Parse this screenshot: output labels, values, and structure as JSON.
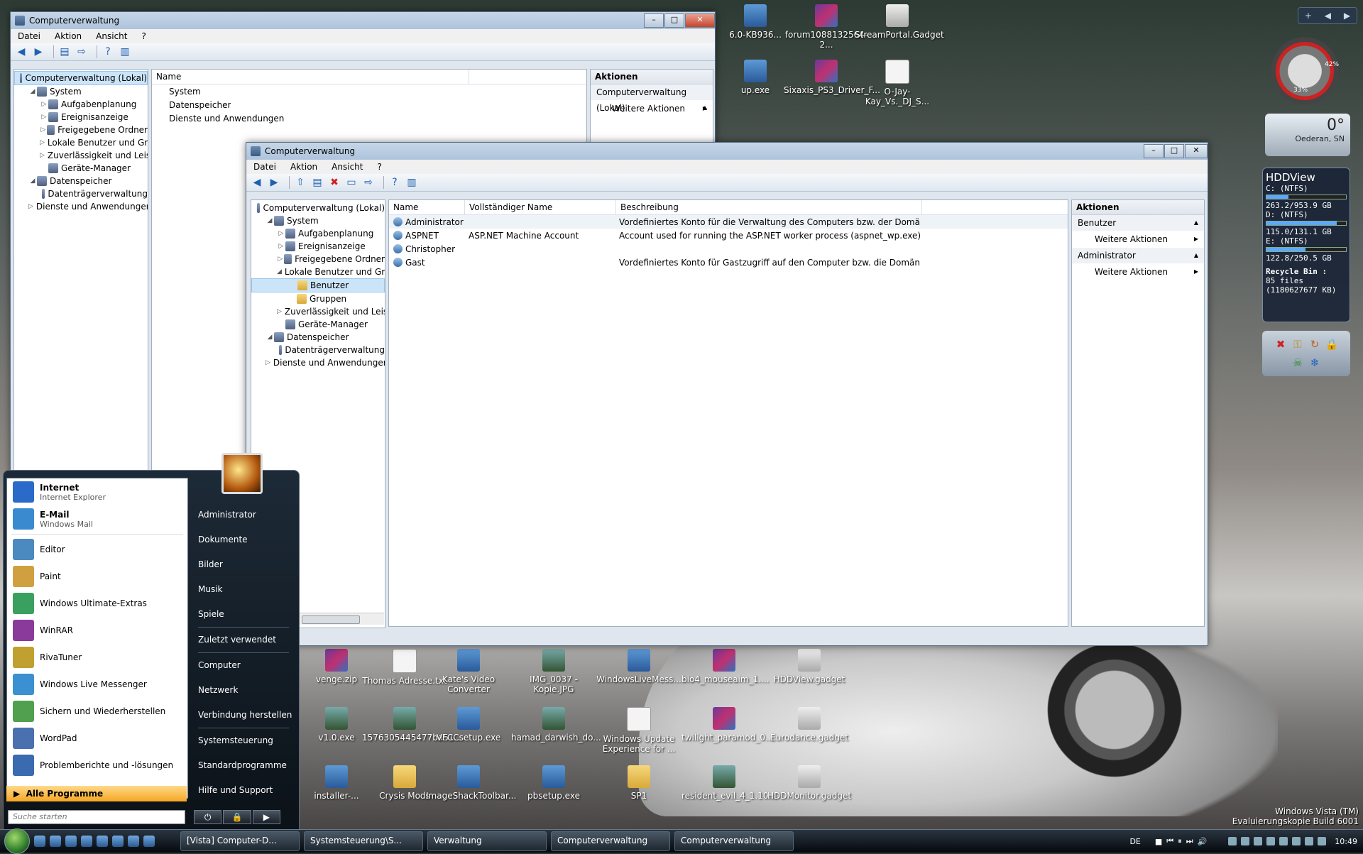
{
  "desktop_icons": [
    {
      "label": "6.0-KB936...",
      "type": "exe",
      "pos": "a1"
    },
    {
      "label": "forum1088132564-2...",
      "type": "rar",
      "pos": "a2"
    },
    {
      "label": "StreamPortal.Gadget",
      "type": "gadget",
      "pos": "a3"
    },
    {
      "label": "up.exe",
      "type": "exe",
      "pos": "b1"
    },
    {
      "label": "Sixaxis_PS3_Driver_F...",
      "type": "rar",
      "pos": "b2"
    },
    {
      "label": "O-Jay-Kay_Vs._DJ_S...",
      "type": "txt",
      "pos": "b3"
    },
    {
      "label": "venge.zip",
      "type": "rar",
      "pos": "c0"
    },
    {
      "label": "Thomas Adresse.txt",
      "type": "txt",
      "pos": "c1"
    },
    {
      "label": "Kate's Video Converter",
      "type": "exe",
      "pos": "c2"
    },
    {
      "label": "IMG_0037 - Kopie.JPG",
      "type": "img",
      "pos": "c3"
    },
    {
      "label": "WindowsLiveMess...",
      "type": "exe",
      "pos": "c4"
    },
    {
      "label": "bio4_mouseaim_1....",
      "type": "rar",
      "pos": "c5"
    },
    {
      "label": "HDDView.gadget",
      "type": "gadget",
      "pos": "c6"
    },
    {
      "label": "v1.0.exe",
      "type": "img",
      "pos": "d0"
    },
    {
      "label": "1576305445477ba51...",
      "type": "img",
      "pos": "d1"
    },
    {
      "label": "VFCCsetup.exe",
      "type": "exe",
      "pos": "d2"
    },
    {
      "label": "hamad_darwish_do...",
      "type": "img",
      "pos": "d3"
    },
    {
      "label": "Windows Update Experience for ...",
      "type": "txt",
      "pos": "d4"
    },
    {
      "label": "twilight_paramod_0...",
      "type": "rar",
      "pos": "d5"
    },
    {
      "label": "Eurodance.gadget",
      "type": "gadget",
      "pos": "d6"
    },
    {
      "label": "installer-...",
      "type": "exe",
      "pos": "e0"
    },
    {
      "label": "Crysis Mods",
      "type": "folder",
      "pos": "e1"
    },
    {
      "label": "ImageShackToolbar...",
      "type": "exe",
      "pos": "e2"
    },
    {
      "label": "pbsetup.exe",
      "type": "exe",
      "pos": "e3"
    },
    {
      "label": "SP1",
      "type": "folder",
      "pos": "e4"
    },
    {
      "label": "resident_evil_4_1.10...",
      "type": "img",
      "pos": "e5"
    },
    {
      "label": "HDDMonitor.gadget",
      "type": "gadget",
      "pos": "e6"
    }
  ],
  "back_window": {
    "title": "Computerverwaltung",
    "menu": [
      "Datei",
      "Aktion",
      "Ansicht",
      "?"
    ],
    "tree": [
      {
        "label": "Computerverwaltung (Lokal)",
        "level": 0,
        "arrow": "",
        "selected": true
      },
      {
        "label": "System",
        "level": 1,
        "arrow": "◢"
      },
      {
        "label": "Aufgabenplanung",
        "level": 2,
        "arrow": "▷"
      },
      {
        "label": "Ereignisanzeige",
        "level": 2,
        "arrow": "▷"
      },
      {
        "label": "Freigegebene Ordner",
        "level": 2,
        "arrow": "▷"
      },
      {
        "label": "Lokale Benutzer und Gr",
        "level": 2,
        "arrow": "▷"
      },
      {
        "label": "Zuverlässigkeit und Leis",
        "level": 2,
        "arrow": "▷"
      },
      {
        "label": "Geräte-Manager",
        "level": 2,
        "arrow": ""
      },
      {
        "label": "Datenspeicher",
        "level": 1,
        "arrow": "◢"
      },
      {
        "label": "Datenträgerverwaltung",
        "level": 2,
        "arrow": ""
      },
      {
        "label": "Dienste und Anwendungen",
        "level": 1,
        "arrow": "▷"
      }
    ],
    "list_header": "Name",
    "list_items": [
      "System",
      "Datenspeicher",
      "Dienste und Anwendungen"
    ],
    "actions_title": "Aktionen",
    "actions_section": "Computerverwaltung (Lokal)",
    "actions_item": "Weitere Aktionen"
  },
  "front_window": {
    "title": "Computerverwaltung",
    "menu": [
      "Datei",
      "Aktion",
      "Ansicht",
      "?"
    ],
    "tree": [
      {
        "label": "Computerverwaltung (Lokal)",
        "level": 0,
        "arrow": ""
      },
      {
        "label": "System",
        "level": 1,
        "arrow": "◢"
      },
      {
        "label": "Aufgabenplanung",
        "level": 2,
        "arrow": "▷"
      },
      {
        "label": "Ereignisanzeige",
        "level": 2,
        "arrow": "▷"
      },
      {
        "label": "Freigegebene Ordner",
        "level": 2,
        "arrow": "▷"
      },
      {
        "label": "Lokale Benutzer und Gr",
        "level": 2,
        "arrow": "◢"
      },
      {
        "label": "Benutzer",
        "level": 3,
        "arrow": "",
        "selected": true,
        "folder": true
      },
      {
        "label": "Gruppen",
        "level": 3,
        "arrow": "",
        "folder": true
      },
      {
        "label": "Zuverlässigkeit und Leis",
        "level": 2,
        "arrow": "▷"
      },
      {
        "label": "Geräte-Manager",
        "level": 2,
        "arrow": ""
      },
      {
        "label": "Datenspeicher",
        "level": 1,
        "arrow": "◢"
      },
      {
        "label": "Datenträgerverwaltung",
        "level": 2,
        "arrow": ""
      },
      {
        "label": "Dienste und Anwendungen",
        "level": 1,
        "arrow": "▷"
      }
    ],
    "columns": [
      "Name",
      "Vollständiger Name",
      "Beschreibung"
    ],
    "rows": [
      {
        "name": "Administrator",
        "full": "",
        "desc": "Vordefiniertes Konto für die Verwaltung des Computers bzw. der Domäne"
      },
      {
        "name": "ASPNET",
        "full": "ASP.NET Machine Account",
        "desc": "Account used for running the ASP.NET worker process (aspnet_wp.exe)"
      },
      {
        "name": "Christopher",
        "full": "",
        "desc": ""
      },
      {
        "name": "Gast",
        "full": "",
        "desc": "Vordefiniertes Konto für Gastzugriff auf den Computer bzw. die Domäne"
      }
    ],
    "actions_title": "Aktionen",
    "action_sections": [
      {
        "title": "Benutzer",
        "item": "Weitere Aktionen"
      },
      {
        "title": "Administrator",
        "item": "Weitere Aktionen"
      }
    ]
  },
  "start_menu": {
    "pinned": [
      {
        "title": "Internet",
        "subtitle": "Internet Explorer",
        "color": "#2a6ac8"
      },
      {
        "title": "E-Mail",
        "subtitle": "Windows Mail",
        "color": "#3a8ad0"
      }
    ],
    "recent": [
      {
        "title": "Editor",
        "color": "#4a8ac0"
      },
      {
        "title": "Paint",
        "color": "#d0a040"
      },
      {
        "title": "Windows Ultimate-Extras",
        "color": "#3aa060"
      },
      {
        "title": "WinRAR",
        "color": "#8a3a9a"
      },
      {
        "title": "RivaTuner",
        "color": "#c0a030"
      },
      {
        "title": "Windows Live Messenger",
        "color": "#3a90d0"
      },
      {
        "title": "Sichern und Wiederherstellen",
        "color": "#50a050"
      },
      {
        "title": "WordPad",
        "color": "#4a70b0"
      },
      {
        "title": "Problemberichte und -lösungen",
        "color": "#3a6ab0"
      }
    ],
    "all_programs": "Alle Programme",
    "search_placeholder": "Suche starten",
    "right_items": [
      "Administrator",
      "Dokumente",
      "Bilder",
      "Musik",
      "Spiele",
      "Zuletzt verwendet",
      "Computer",
      "Netzwerk",
      "Verbindung herstellen",
      "Systemsteuerung",
      "Standardprogramme",
      "Hilfe und Support"
    ],
    "power_icons": [
      "⏻",
      "🔒",
      "▶"
    ]
  },
  "taskbar": {
    "tasks": [
      "[Vista] Computer-D...",
      "Systemsteuerung\\S...",
      "Verwaltung",
      "Computerverwaltung",
      "Computerverwaltung"
    ],
    "lang": "DE",
    "clock": "10:49"
  },
  "gadgets": {
    "weather_temp": "0°",
    "weather_place": "Oederan, SN",
    "cpu_pct": "33%",
    "mem_pct": "42%",
    "hdd_title": "HDDView",
    "drives": [
      {
        "label": "C: (NTFS)",
        "usage": "263.2/953.9 GB",
        "fraction": 0.28
      },
      {
        "label": "D: (NTFS)",
        "usage": "115.0/131.1 GB",
        "fraction": 0.88
      },
      {
        "label": "E: (NTFS)",
        "usage": "122.8/250.5 GB",
        "fraction": 0.49
      }
    ],
    "recycle_title": "Recycle Bin :",
    "recycle_files": "85 files",
    "recycle_size": "(1180627677 KB)"
  },
  "watermark": {
    "line1": "Windows Vista (TM)",
    "line2": "Evaluierungskopie Build 6001"
  }
}
